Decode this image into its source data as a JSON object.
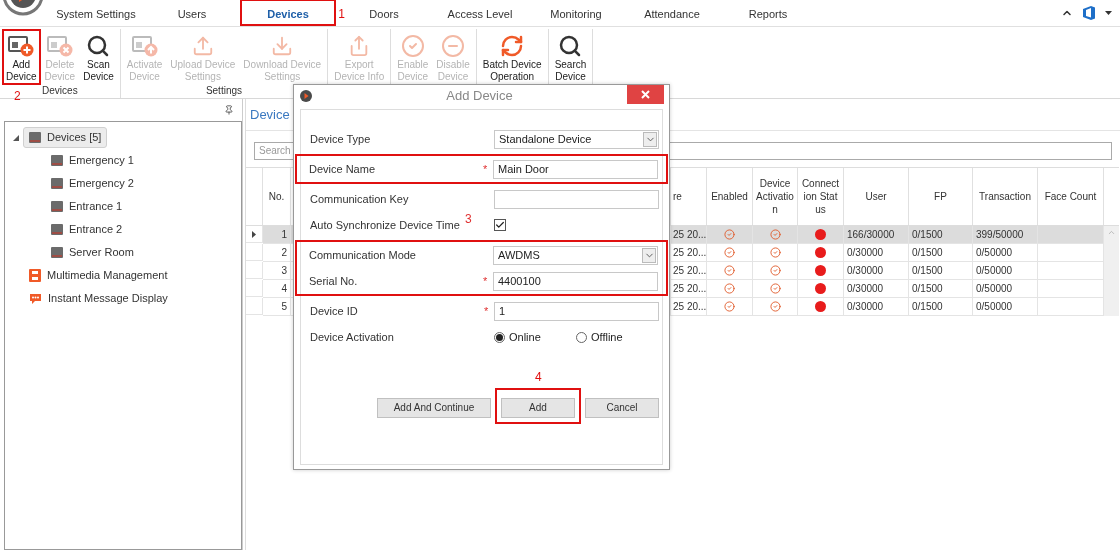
{
  "tabs": [
    {
      "label": "System Settings",
      "selected": false,
      "highlighted": false
    },
    {
      "label": "Users",
      "selected": false,
      "highlighted": false
    },
    {
      "label": "Devices",
      "selected": true,
      "highlighted": true,
      "callout": "1"
    },
    {
      "label": "Doors",
      "selected": false,
      "highlighted": false
    },
    {
      "label": "Access Level",
      "selected": false,
      "highlighted": false
    },
    {
      "label": "Monitoring",
      "selected": false,
      "highlighted": false
    },
    {
      "label": "Attendance",
      "selected": false,
      "highlighted": false
    },
    {
      "label": "Reports",
      "selected": false,
      "highlighted": false
    }
  ],
  "ribbon": [
    {
      "label": "Devices",
      "buttons": [
        {
          "lines": [
            "Add",
            "Device"
          ],
          "kind": "add",
          "disabled": false,
          "highlighted": true,
          "callout": "2"
        },
        {
          "lines": [
            "Delete",
            "Device"
          ],
          "kind": "delete",
          "disabled": true,
          "highlighted": false
        },
        {
          "lines": [
            "Scan",
            "Device"
          ],
          "kind": "search",
          "disabled": false,
          "highlighted": false
        }
      ]
    },
    {
      "label": "Settings",
      "buttons": [
        {
          "lines": [
            "Activate",
            "Device"
          ],
          "kind": "activate",
          "disabled": true,
          "highlighted": false
        },
        {
          "lines": [
            "Upload Device",
            "Settings"
          ],
          "kind": "upload",
          "disabled": true,
          "highlighted": false
        },
        {
          "lines": [
            "Download Device",
            "Settings"
          ],
          "kind": "download",
          "disabled": true,
          "highlighted": false
        }
      ]
    },
    {
      "buttons": [
        {
          "lines": [
            "Export",
            "Device Info"
          ],
          "kind": "export",
          "disabled": true,
          "highlighted": false
        }
      ]
    },
    {
      "buttons": [
        {
          "lines": [
            "Enable",
            "Device"
          ],
          "kind": "enable",
          "disabled": true,
          "highlighted": false
        },
        {
          "lines": [
            "Disable",
            "Device"
          ],
          "kind": "disable",
          "disabled": true,
          "highlighted": false
        }
      ]
    },
    {
      "buttons": [
        {
          "lines": [
            "Batch Device",
            "Operation"
          ],
          "kind": "batch",
          "disabled": false,
          "highlighted": false
        }
      ]
    },
    {
      "buttons": [
        {
          "lines": [
            "Search",
            "Device"
          ],
          "kind": "search",
          "disabled": false,
          "highlighted": false
        }
      ]
    }
  ],
  "tree": [
    {
      "label": "Devices [5]",
      "kind": "device",
      "selected": true,
      "expanded": true,
      "children": [
        {
          "label": "Emergency 1",
          "kind": "device",
          "selected": false
        },
        {
          "label": "Emergency 2",
          "kind": "device",
          "selected": false
        },
        {
          "label": "Entrance 1",
          "kind": "device",
          "selected": false
        },
        {
          "label": "Entrance 2",
          "kind": "device",
          "selected": false
        },
        {
          "label": "Server Room",
          "kind": "device",
          "selected": false
        }
      ]
    },
    {
      "label": "Multimedia Management",
      "kind": "multimedia",
      "selected": false
    },
    {
      "label": "Instant Message Display",
      "kind": "message",
      "selected": false
    }
  ],
  "main": {
    "title": "Device",
    "search": {
      "placeholder": "Search"
    },
    "table": {
      "columns": [
        "No.",
        "re",
        "Enabled",
        "Device Activation",
        "Connection Status",
        "User",
        "FP",
        "Transaction",
        "Face Count"
      ],
      "rows": [
        {
          "selected": true,
          "no": "1",
          "column_re": "25 20...",
          "enabled": true,
          "activated": true,
          "color": "#e81c1c",
          "user": "166/30000",
          "fp": "0/1500",
          "transaction": "399/50000"
        },
        {
          "selected": false,
          "no": "2",
          "column_re": "25 20...",
          "enabled": true,
          "activated": true,
          "color": "#e81c1c",
          "user": "0/30000",
          "fp": "0/1500",
          "transaction": "0/50000"
        },
        {
          "selected": false,
          "no": "3",
          "column_re": "25 20...",
          "enabled": true,
          "activated": true,
          "color": "#e81c1c",
          "user": "0/30000",
          "fp": "0/1500",
          "transaction": "0/50000"
        },
        {
          "selected": false,
          "no": "4",
          "column_re": "25 20...",
          "enabled": true,
          "activated": true,
          "color": "#e81c1c",
          "user": "0/30000",
          "fp": "0/1500",
          "transaction": "0/50000"
        },
        {
          "selected": false,
          "no": "5",
          "column_re": "25 20...",
          "enabled": true,
          "activated": true,
          "color": "#e81c1c",
          "user": "0/30000",
          "fp": "0/1500",
          "transaction": "0/50000"
        }
      ]
    }
  },
  "dialog": {
    "title": "Add Device",
    "fields": [
      {
        "kind": "select",
        "label": "Device Type",
        "value": "Standalone Device",
        "highlighted": false
      },
      {
        "kind": "text",
        "label": "Device Name",
        "required_mark": "*",
        "value": "Main Door",
        "highlighted": true
      },
      {
        "kind": "text",
        "label": "Communication Key",
        "highlighted": false
      },
      {
        "kind": "checkbox",
        "label": "Auto Synchronize Device Time",
        "checked": true,
        "highlighted": false,
        "callout": "3"
      },
      {
        "kind": "select",
        "label": "Communication Mode",
        "value": "AWDMS",
        "highlighted": true
      },
      {
        "kind": "text",
        "label": "Serial No.",
        "required_mark": "*",
        "value": "4400100",
        "highlighted": true
      },
      {
        "kind": "text",
        "label": "Device ID",
        "required_mark": "*",
        "value": "1",
        "highlighted": false
      },
      {
        "kind": "radio",
        "label": "Device Activation",
        "highlighted": false,
        "options": [
          {
            "label": "Online",
            "selected": true
          },
          {
            "label": "Offline",
            "selected": false
          }
        ]
      }
    ],
    "buttons": [
      {
        "label": "Add And Continue",
        "highlighted": false
      },
      {
        "label": "Add",
        "highlighted": true,
        "callout": "4"
      },
      {
        "label": "Cancel",
        "highlighted": false
      }
    ]
  }
}
